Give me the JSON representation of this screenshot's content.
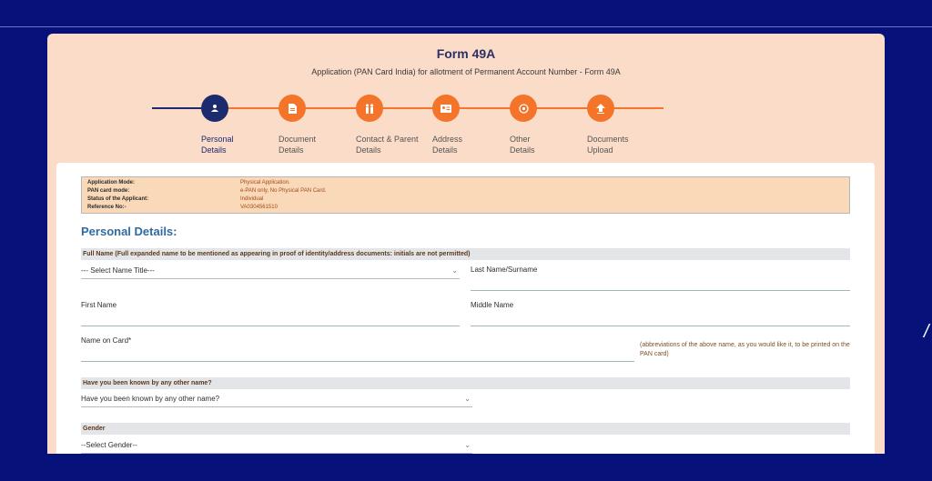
{
  "header": {
    "title": "Form 49A",
    "subtitle": "Application (PAN Card India) for allotment of Permanent Account Number - Form 49A"
  },
  "steps": [
    {
      "label_line1": "Personal",
      "label_line2": "Details",
      "icon": "user-icon",
      "active": true
    },
    {
      "label_line1": "Document",
      "label_line2": "Details",
      "icon": "document-icon",
      "active": false
    },
    {
      "label_line1": "Contact & Parent",
      "label_line2": "Details",
      "icon": "family-icon",
      "active": false
    },
    {
      "label_line1": "Address",
      "label_line2": "Details",
      "icon": "address-card-icon",
      "active": false
    },
    {
      "label_line1": "Other",
      "label_line2": "Details",
      "icon": "target-icon",
      "active": false
    },
    {
      "label_line1": "Documents",
      "label_line2": "Upload",
      "icon": "upload-icon",
      "active": false
    }
  ],
  "info": [
    {
      "label": "Application Mode:",
      "value": "Physical Application."
    },
    {
      "label": "PAN card mode:",
      "value": "e-PAN only, No Physical PAN Card."
    },
    {
      "label": "Status of the Applicant:",
      "value": "Individual"
    },
    {
      "label": "Reference No:-",
      "value": "VA0304561510"
    }
  ],
  "section": {
    "title": "Personal Details:"
  },
  "fullname": {
    "bar": "Full Name (Full expanded name to be mentioned as appearing in proof of identity/address documents: initials are not permitted)",
    "title_select": "--- Select Name Title---",
    "last_name_label": "Last Name/Surname",
    "first_name_label": "First Name",
    "middle_name_label": "Middle Name",
    "name_on_card_label": "Name on Card*",
    "name_on_card_hint": "(abbreviations of the above name, as you would like it, to be printed on the PAN card)"
  },
  "other_name": {
    "bar": "Have you been known by any other name?",
    "select": "Have you been known by any other name?"
  },
  "gender": {
    "bar": "Gender",
    "select": "--Select Gender--"
  },
  "colors": {
    "background": "#06127a",
    "card": "#fbdcc9",
    "step_active": "#1c2a6e",
    "step_todo": "#f4742a",
    "section_title": "#2f6aa1"
  }
}
